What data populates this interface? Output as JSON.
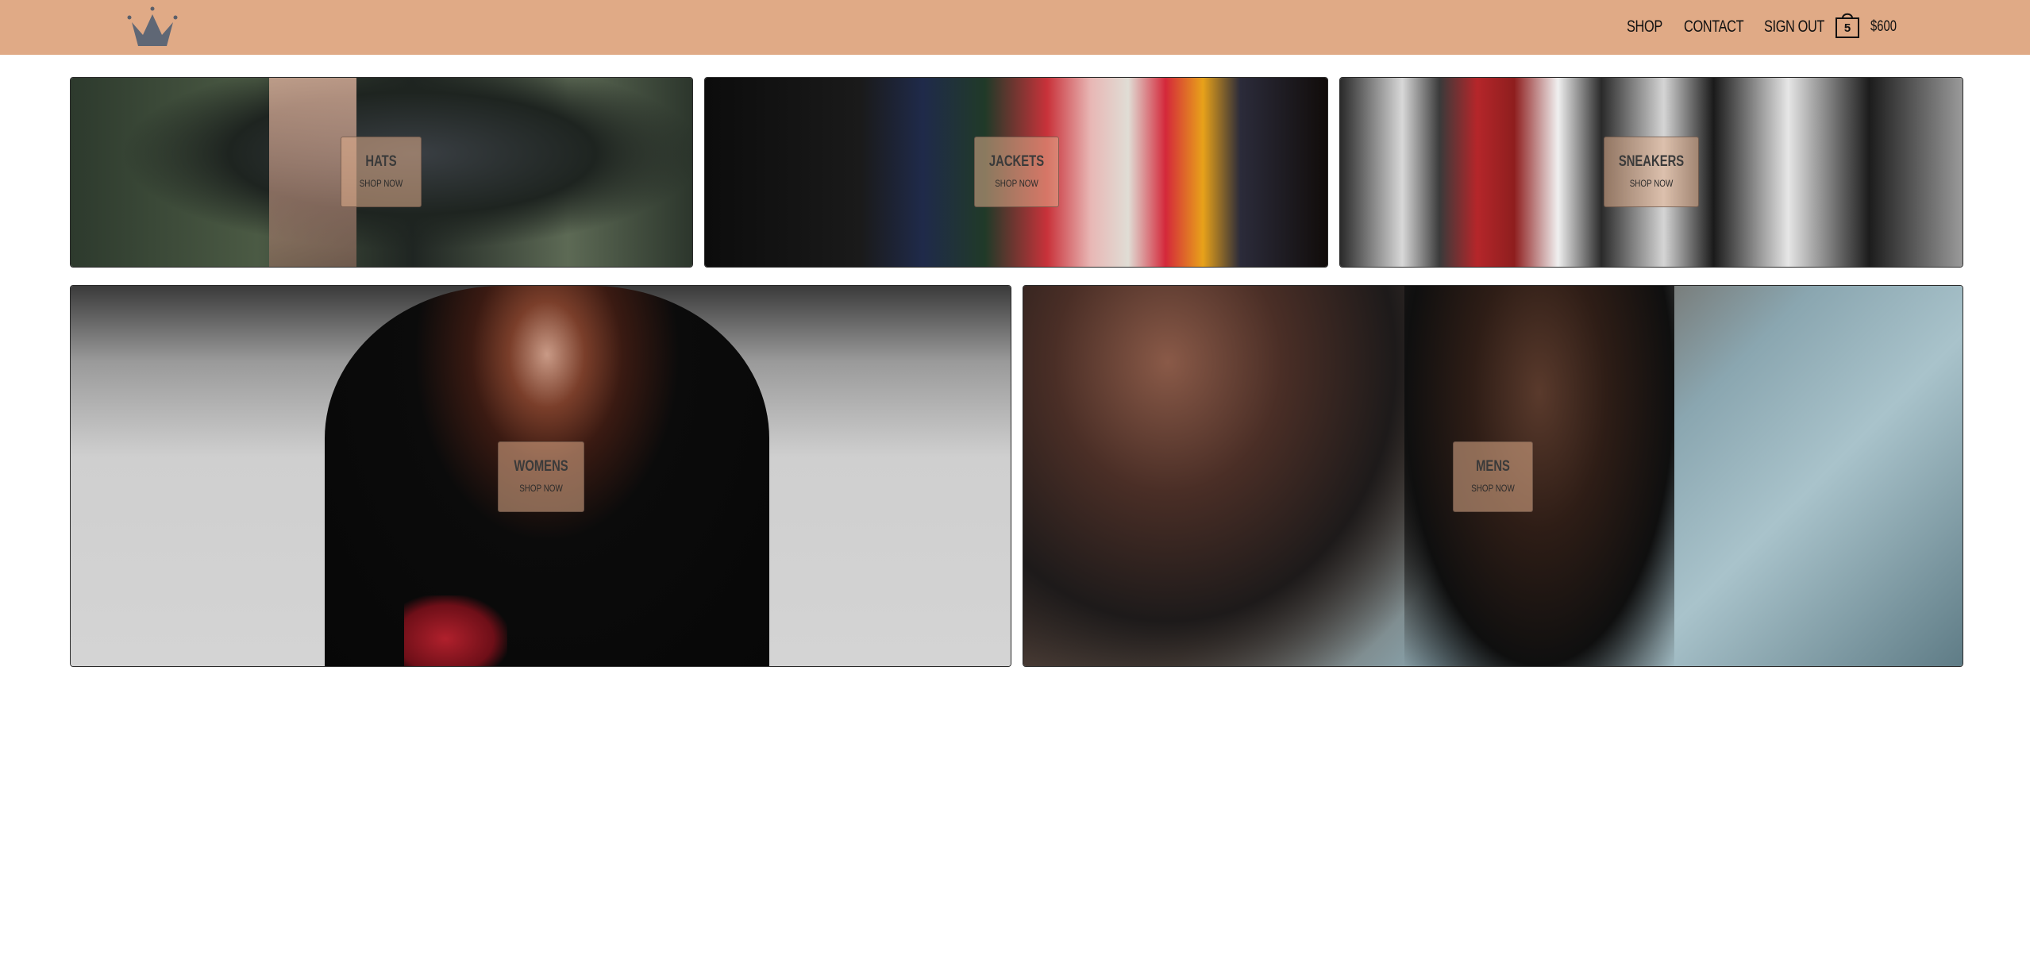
{
  "header": {
    "logo_icon": "crown-icon",
    "nav": {
      "shop": "SHOP",
      "contact": "CONTACT",
      "sign_out": "SIGN OUT"
    },
    "cart": {
      "icon": "shopping-bag-icon",
      "count": "5",
      "total": "$600"
    },
    "background_color": "#e0aa86"
  },
  "categories": [
    {
      "title": "HATS",
      "cta": "SHOP NOW"
    },
    {
      "title": "JACKETS",
      "cta": "SHOP NOW"
    },
    {
      "title": "SNEAKERS",
      "cta": "SHOP NOW"
    },
    {
      "title": "WOMENS",
      "cta": "SHOP NOW"
    },
    {
      "title": "MENS",
      "cta": "SHOP NOW"
    }
  ]
}
